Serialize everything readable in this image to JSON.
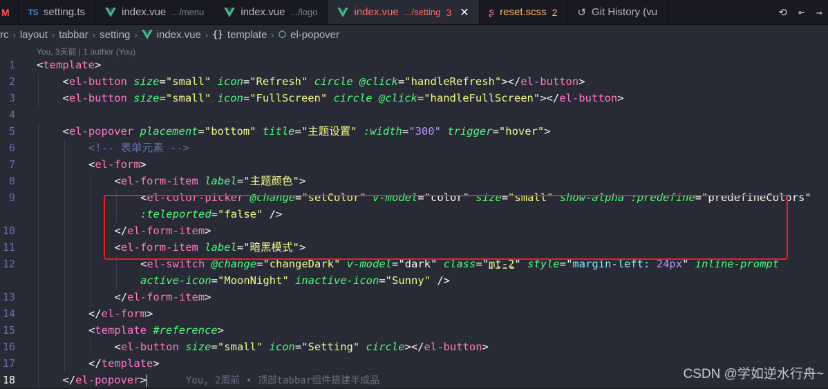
{
  "tabs": [
    {
      "icon": "modified-m-icon",
      "icon_text": "M",
      "name": "",
      "desc": "",
      "count": "",
      "close": ""
    },
    {
      "icon": "typescript-icon",
      "icon_text": "TS",
      "name": "setting.ts",
      "desc": "",
      "count": "",
      "close": ""
    },
    {
      "icon": "vue-icon",
      "icon_text": "",
      "name": "index.vue",
      "desc": ".../menu",
      "count": "",
      "close": ""
    },
    {
      "icon": "vue-icon",
      "icon_text": "",
      "name": "index.vue",
      "desc": ".../logo",
      "count": "",
      "close": ""
    },
    {
      "icon": "vue-icon",
      "icon_text": "",
      "name": "index.vue",
      "desc": ".../setting",
      "count": "3",
      "close": "✕"
    },
    {
      "icon": "sass-icon",
      "icon_text": "ʂ",
      "name": "reset.scss",
      "desc": "",
      "count": "2",
      "close": ""
    },
    {
      "icon": "history-icon",
      "icon_text": "↺",
      "name": "Git History (vu",
      "desc": "",
      "count": "",
      "close": ""
    }
  ],
  "breadcrumb": {
    "items": [
      "rc",
      "layout",
      "tabbar",
      "setting",
      "index.vue",
      "template",
      "el-popover"
    ],
    "braces": "{}"
  },
  "editor": {
    "blame_header": "You, 3天前 | 1 author (You)",
    "inline_blame": "You, 2周前 • 顶部tabbar组件搭建半成品",
    "line_numbers": [
      "1",
      "2",
      "3",
      "4",
      "5",
      "6",
      "7",
      "8",
      "9",
      "",
      "10",
      "11",
      "12",
      "",
      "13",
      "14",
      "15",
      "16",
      "17",
      "18"
    ],
    "strings": {
      "template": "template",
      "el_button": "el-button",
      "el_popover": "el-popover",
      "el_form": "el-form",
      "el_form_item": "el-form-item",
      "el_color_picker": "el-color-picker",
      "el_switch": "el-switch",
      "size": "size",
      "small": "\"small\"",
      "icon": "icon",
      "refresh": "\"Refresh\"",
      "fullscreen": "\"FullScreen\"",
      "circle": "circle",
      "click": "@click",
      "handle_refresh": "\"handleRefresh\"",
      "handle_fullscreen": "\"handleFullScreen\"",
      "placement": "placement",
      "bottom": "\"bottom\"",
      "title": "title",
      "title_val": "\"主题设置\"",
      "width": ":width",
      "width_val": "\"300\"",
      "trigger": "trigger",
      "hover": "\"hover\"",
      "comment": "<!-- 表单元素 -->",
      "label": "label",
      "label_color": "\"主题颜色\"",
      "change": "@change",
      "set_color": "\"setColor\"",
      "v_model": "v-model",
      "color": "\"color\"",
      "show_alpha": "show-alpha",
      "predefine": ":predefine",
      "predefine_val": "\"predefineColors\"",
      "teleported": ":teleported",
      "false_val": "\"false\"",
      "label_dark": "\"暗黑模式\"",
      "change_dark": "\"changeDark\"",
      "dark": "\"dark\"",
      "class": "class",
      "mt2": "mt-2",
      "style": "style",
      "margin_left": "margin-left:",
      "px24": "24px",
      "inline_prompt": "inline-prompt",
      "active_icon": "active-icon",
      "moon": "\"MoonNight\"",
      "inactive_icon": "inactive-icon",
      "sunny": "\"Sunny\"",
      "reference": "#reference",
      "setting": "\"Setting\""
    }
  },
  "watermark": "CSDN @学如逆水行舟~"
}
